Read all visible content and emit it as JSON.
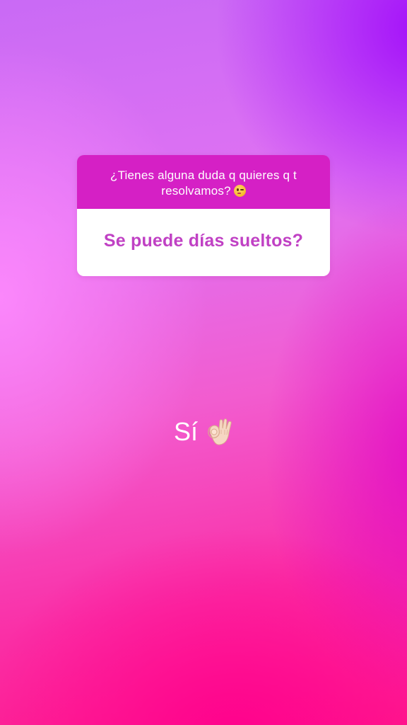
{
  "story": {
    "question_box": {
      "question": "¿Tienes alguna duda q quieres q t resolvamos?",
      "question_emoji": "winking-face-icon",
      "answer": "Se puede días sueltos?"
    },
    "reply": {
      "text": "Sí",
      "emoji": "ok-hand-icon"
    }
  },
  "colors": {
    "question_header_bg": "#d520c5",
    "answer_text": "#c041c4",
    "answer_bg": "#ffffff"
  }
}
